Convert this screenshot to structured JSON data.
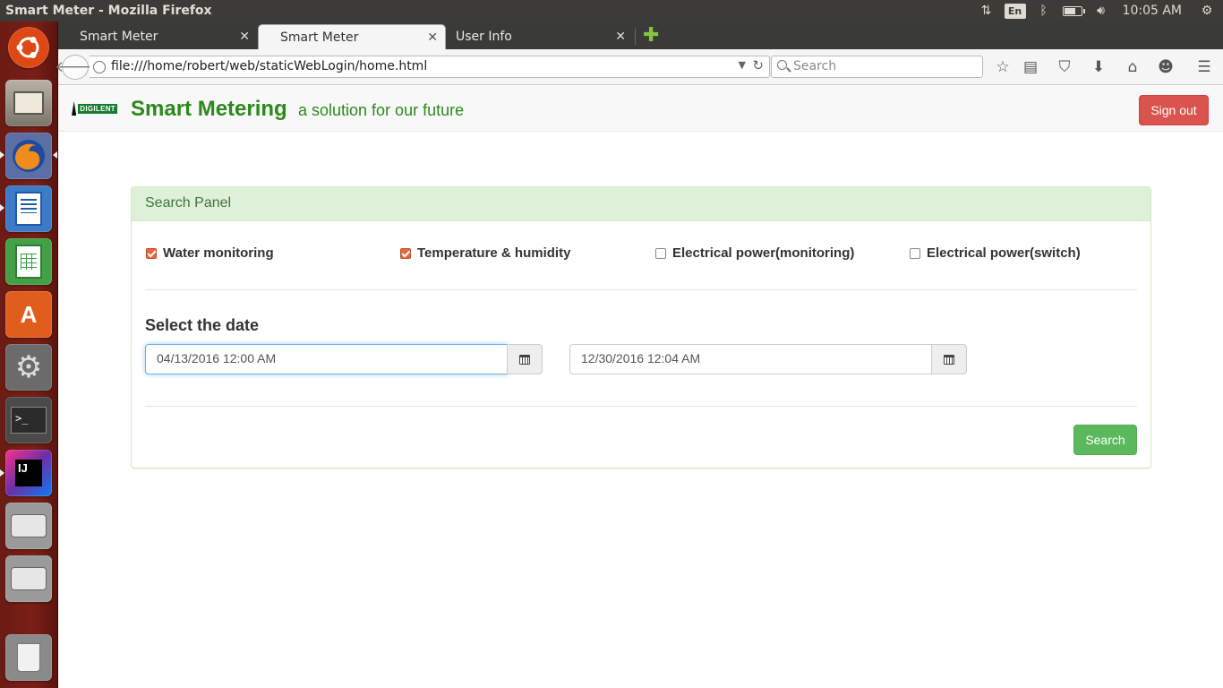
{
  "window": {
    "title": "Smart Meter - Mozilla Firefox"
  },
  "system_tray": {
    "keyboard_layout": "En",
    "battery_level": 0.7,
    "clock": "10:05 AM"
  },
  "launcher": {
    "items": [
      {
        "name": "ubuntu-dash-icon",
        "color": "#dd4814"
      },
      {
        "name": "files-icon",
        "color": "#8a8478"
      },
      {
        "name": "firefox-icon",
        "color": "#e66000"
      },
      {
        "name": "libreoffice-writer-icon",
        "color": "#1e5ba8"
      },
      {
        "name": "libreoffice-calc-icon",
        "color": "#2ea043"
      },
      {
        "name": "software-center-icon",
        "color": "#e05d1e"
      },
      {
        "name": "system-settings-icon",
        "color": "#9b9b9b"
      },
      {
        "name": "terminal-icon",
        "color": "#2d2d2d"
      },
      {
        "name": "intellij-idea-icon",
        "color": "#6b2fa6"
      },
      {
        "name": "drive-icon",
        "color": "#d4d4d4"
      },
      {
        "name": "drive-icon-2",
        "color": "#d4d4d4"
      },
      {
        "name": "trash-icon",
        "color": "#e8e8e8"
      }
    ]
  },
  "tabs": [
    {
      "label": "Smart Meter",
      "active": false
    },
    {
      "label": "Smart Meter",
      "active": true
    },
    {
      "label": "User Info",
      "active": false
    }
  ],
  "navbar": {
    "url": "file:///home/robert/web/staticWebLogin/home.html",
    "search_placeholder": "Search"
  },
  "app": {
    "logo_text": "DIGILENT",
    "brand": "Smart Metering",
    "tagline": "a solution for our future",
    "sign_out_label": "Sign out",
    "accent_green": "#2b8a1b",
    "danger_red": "#d9534f"
  },
  "panel": {
    "title": "Search Panel",
    "checkboxes": [
      {
        "label": "Water monitoring",
        "checked": true
      },
      {
        "label": "Temperature & humidity",
        "checked": true
      },
      {
        "label": "Electrical power(monitoring)",
        "checked": false
      },
      {
        "label": "Electrical power(switch)",
        "checked": false
      }
    ],
    "date_label": "Select the date",
    "start_date": "04/13/2016 12:00 AM",
    "end_date": "12/30/2016 12:04 AM",
    "search_label": "Search"
  }
}
